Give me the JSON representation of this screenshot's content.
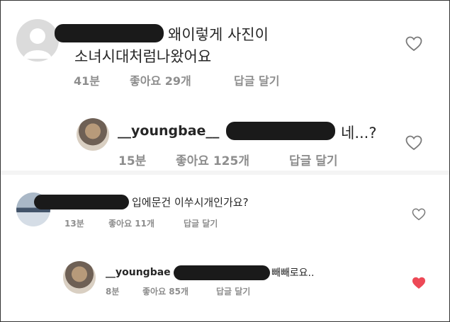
{
  "comments": [
    {
      "text_line1": "왜이렇게 사진이",
      "text_line2": "소녀시대처럼나왔어요",
      "time": "41분",
      "likes": "좋아요 29개",
      "reply": "답글 달기",
      "liked": false
    },
    {
      "username": "__youngbae__",
      "text": "네...?",
      "time": "15분",
      "likes": "좋아요 125개",
      "reply": "답글 달기",
      "liked": false
    },
    {
      "text": "입에문건 이쑤시개인가요?",
      "time": "13분",
      "likes": "좋아요 11개",
      "reply": "답글 달기",
      "liked": false
    },
    {
      "username": "__youngbae",
      "text": "빼빼로요..",
      "time": "8분",
      "likes": "좋아요 85개",
      "reply": "답글 달기",
      "liked": true
    }
  ],
  "colors": {
    "heart_outline": "#8e8e8e",
    "heart_liked": "#ed4956",
    "meta_text": "#8e8e8e"
  },
  "icons": {
    "like": "heart-icon",
    "liked": "heart-filled-icon",
    "default_avatar": "user-silhouette-icon"
  }
}
